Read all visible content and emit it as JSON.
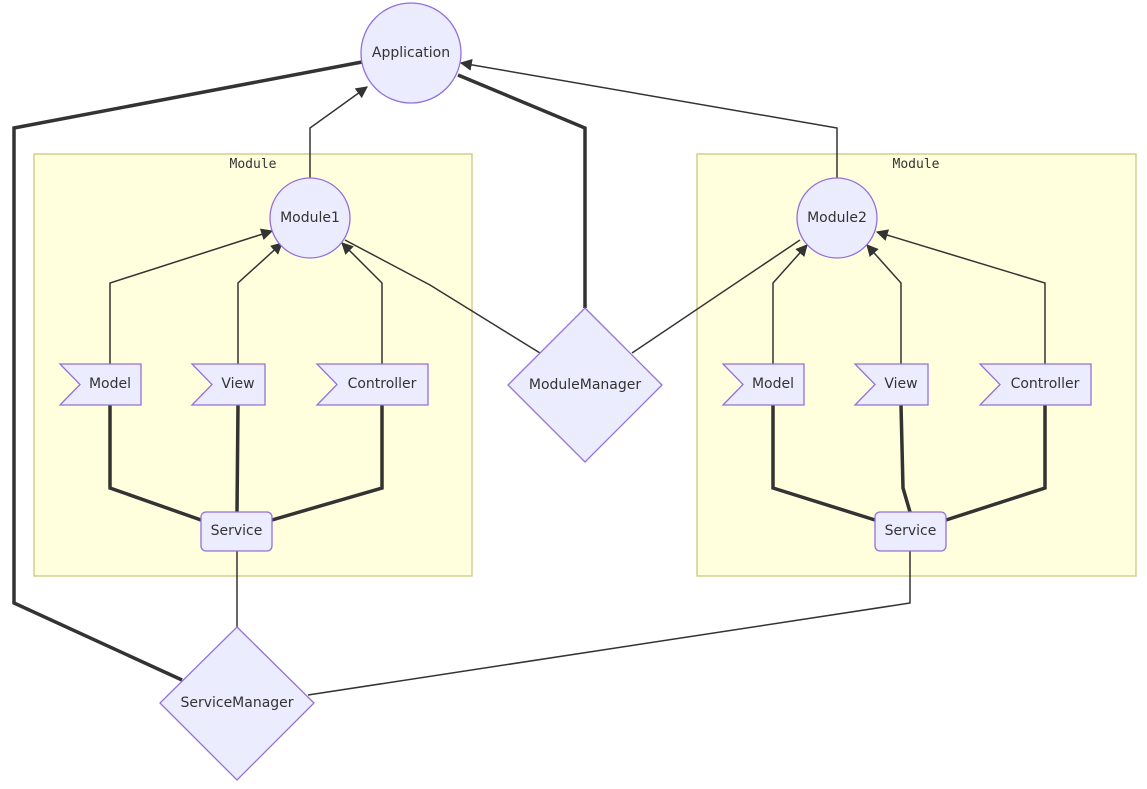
{
  "clusters": [
    {
      "title": "Module"
    },
    {
      "title": "Module"
    }
  ],
  "nodes": {
    "application": "Application",
    "module1": "Module1",
    "module2": "Module2",
    "module_manager": "ModuleManager",
    "service_manager": "ServiceManager",
    "left": {
      "model": "Model",
      "view": "View",
      "controller": "Controller",
      "service": "Service"
    },
    "right": {
      "model": "Model",
      "view": "View",
      "controller": "Controller",
      "service": "Service"
    }
  },
  "colors": {
    "node_fill": "#ECECFF",
    "node_stroke": "#9370DB",
    "cluster_fill": "#ffffde",
    "cluster_stroke": "#c8c880",
    "edge": "#333333"
  }
}
